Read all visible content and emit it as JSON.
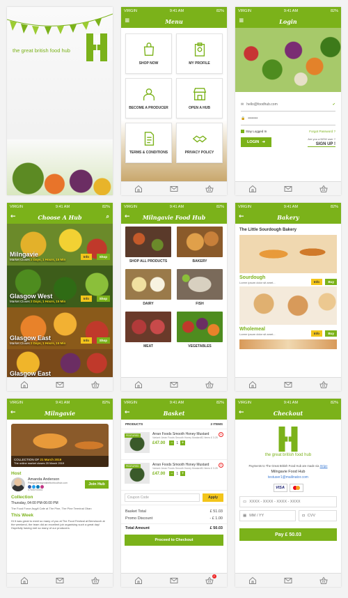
{
  "status": {
    "carrier": "VIRGIN",
    "battery": "82%"
  },
  "splash": {
    "tagline": "the great british food hub"
  },
  "menu": {
    "title": "Menu",
    "items": [
      "SHOP NOW",
      "MY PROFILE",
      "BECOME A PRODUCER",
      "OPEN A HUB",
      "TERMS & CONDITIONS",
      "PRIVACY POLICY"
    ]
  },
  "login": {
    "title": "Login",
    "email": "hello@foodhub.com",
    "password": "••••••••",
    "stay_logged": "Stay Logged In",
    "forgot": "Forgot Password ?",
    "button": "LOGIN",
    "new_user": "Are you a NEW user ?",
    "signup": "SIGN UP !"
  },
  "choose": {
    "title": "Choose A Hub",
    "hubs": [
      {
        "name": "Milngavie",
        "prefix": "Market Closes ",
        "closes": "2 Days, 1 Hours, 15 Min"
      },
      {
        "name": "Glasgow West",
        "prefix": "Market Closes ",
        "closes": "2 Days, 1 Hours, 15 Min"
      },
      {
        "name": "Glasgow East",
        "prefix": "Market Closes ",
        "closes": "2 Days, 1 Hours, 15 Min"
      },
      {
        "name": "Glasgow East",
        "prefix": "",
        "closes": ""
      }
    ],
    "info": "Info",
    "shop": "Shop"
  },
  "cats": {
    "title": "Milngavie Food Hub",
    "items": [
      "SHOP ALL PRODUCTS",
      "BAKERY",
      "DAIRY",
      "FISH",
      "MEAT",
      "VEGETABLES"
    ]
  },
  "bakery": {
    "title": "Bakery",
    "shop": "The Little Sourdough Bakery",
    "products": [
      {
        "name": "Sourdough",
        "desc": "Lorem ipsum dolor sit amet..."
      },
      {
        "name": "Wholemeal",
        "desc": "Lorem ipsum dolor sit amet..."
      }
    ],
    "info": "Info",
    "buy": "Buy"
  },
  "hubinfo": {
    "title": "Milngavie",
    "collection_label": "COLLECTION OF",
    "collection_date": "21 March 2019",
    "banner_sub": "The online market closes 20 March 2019",
    "host_h": "Host",
    "host_name": "Amanda  Anderson",
    "host_email": "Petege@thegreatbritishfoodhub.com",
    "host_phone": "07505700002",
    "join": "Join Hub",
    "coll_h": "Collection",
    "coll_time": "Thursday, 04:00 PM-06:00 PM",
    "coll_addr": "The Food Force Argyll Cafe at The Pine, The Pine Terminal Oban",
    "week_h": "This Week",
    "week_text": "Hi It was great to meet so many of you at The Food Festival at Bemdocxh at the weekend, the team did an excellent job organising such a great day! Hopefully having met so many of our producers"
  },
  "basket": {
    "title": "Basket",
    "products_lbl": "PRODUCTS",
    "count": "2 ITEMS",
    "items": [
      {
        "name": "Arran Foods Smooth Honey Mustard",
        "variant_lbl": "Variant",
        "variant": "Arran Foods Smooth Honey Mustard£1 Items £ 3.25",
        "price": "£47.00",
        "qty": "1",
        "tag": "FEATURED"
      },
      {
        "name": "Arran Foods Smooth Honey Mustard",
        "variant_lbl": "Variant",
        "variant": "Arran Foods Smooth Honey Mustard£1 Items £ 3.25",
        "price": "£47.00",
        "qty": "1",
        "tag": "FEATURED"
      }
    ],
    "coupon": "Coupon Code",
    "apply": "Apply",
    "totals": [
      {
        "label": "Basket Total",
        "value": "£ 51.03"
      },
      {
        "label": "Promo Discount",
        "value": "- £ 1.00"
      }
    ],
    "total_label": "Total Amount",
    "total_value": "£ 50.03",
    "proceed": "Proceed to Checkout",
    "badge": "2"
  },
  "checkout": {
    "title": "Checkout",
    "tagline": "the great british food hub",
    "pay_text": "Payments to The Great British Food Hub are made via",
    "stripe": "Stripe",
    "hub": "Milngavie Food Hub",
    "user": "testuser1@mailinator.com",
    "card": "XXXX - XXXX - XXXX - XXXX",
    "exp": "MM / YY",
    "cvv": "CVV",
    "pay": "Pay £ 50.03",
    "visa": "VISA"
  },
  "colors": {
    "green": "#7bb21a",
    "yellow": "#f3c51a"
  }
}
